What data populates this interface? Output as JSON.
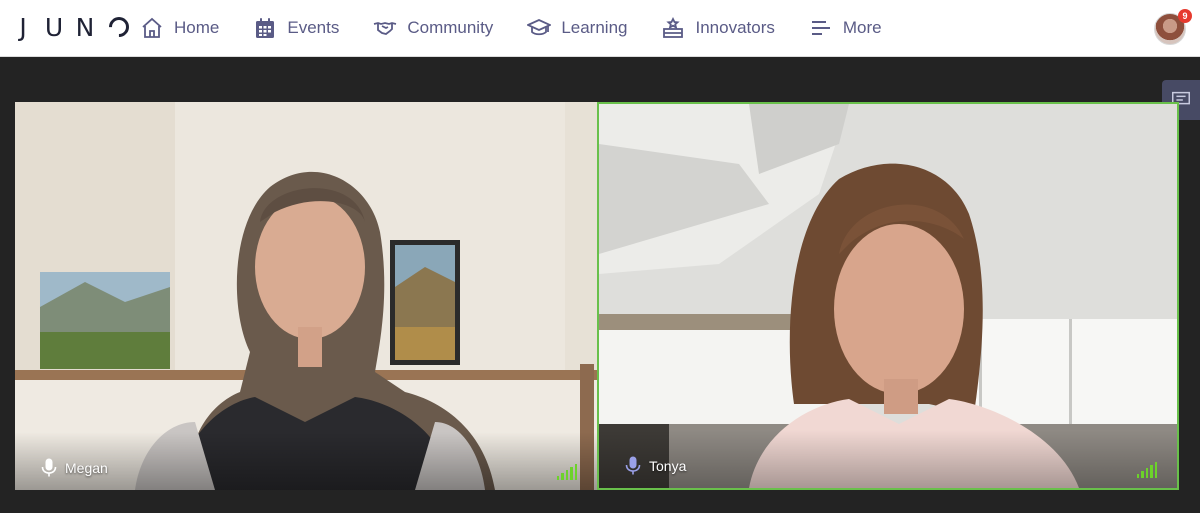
{
  "app": {
    "logo_letters": [
      "J",
      "U",
      "N"
    ],
    "brand_color": "#1f2235",
    "nav_color": "#5a5b86",
    "accent_green": "#69c04b"
  },
  "nav": [
    {
      "label": "Home",
      "icon": "home-icon"
    },
    {
      "label": "Events",
      "icon": "calendar-icon"
    },
    {
      "label": "Community",
      "icon": "handshake-icon"
    },
    {
      "label": "Learning",
      "icon": "graduation-cap-icon"
    },
    {
      "label": "Innovators",
      "icon": "podium-icon"
    },
    {
      "label": "More",
      "icon": "menu-lines-icon"
    }
  ],
  "user": {
    "notification_count": "9",
    "avatar_icon": "user-avatar"
  },
  "sidebar": {
    "chat_icon": "chat-icon"
  },
  "participants": [
    {
      "name": "Megan",
      "mic_icon": "microphone-icon",
      "signal_level": 4,
      "active_speaker": false
    },
    {
      "name": "Tonya",
      "mic_icon": "microphone-icon",
      "signal_level": 4,
      "active_speaker": true
    }
  ]
}
